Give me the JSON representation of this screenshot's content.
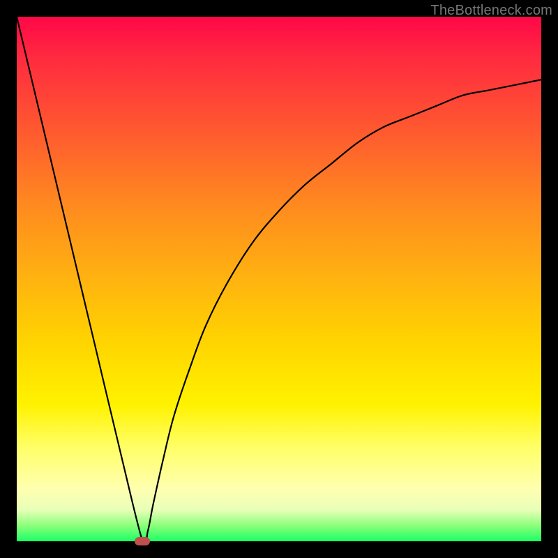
{
  "watermark": "TheBottleneck.com",
  "chart_data": {
    "type": "line",
    "title": "",
    "xlabel": "",
    "ylabel": "",
    "xlim": [
      0,
      100
    ],
    "ylim": [
      0,
      100
    ],
    "grid": false,
    "legend": false,
    "series": [
      {
        "name": "curve",
        "x": [
          0,
          5,
          10,
          15,
          20,
          24,
          25,
          26,
          28,
          30,
          33,
          36,
          40,
          45,
          50,
          55,
          60,
          65,
          70,
          75,
          80,
          85,
          90,
          95,
          100
        ],
        "values": [
          100,
          79,
          58,
          37,
          16,
          0,
          2,
          7,
          16,
          24,
          33,
          41,
          49,
          57,
          63,
          68,
          72,
          76,
          79,
          81,
          83,
          85,
          86,
          87,
          88
        ]
      }
    ],
    "minimum_marker": {
      "x_pct": 24,
      "y_pct": 0,
      "color": "#c0504d"
    },
    "gradient_stops": [
      {
        "pos": 0,
        "color": "#ff0748"
      },
      {
        "pos": 50,
        "color": "#ffb310"
      },
      {
        "pos": 75,
        "color": "#fff200"
      },
      {
        "pos": 100,
        "color": "#1bff66"
      }
    ]
  }
}
